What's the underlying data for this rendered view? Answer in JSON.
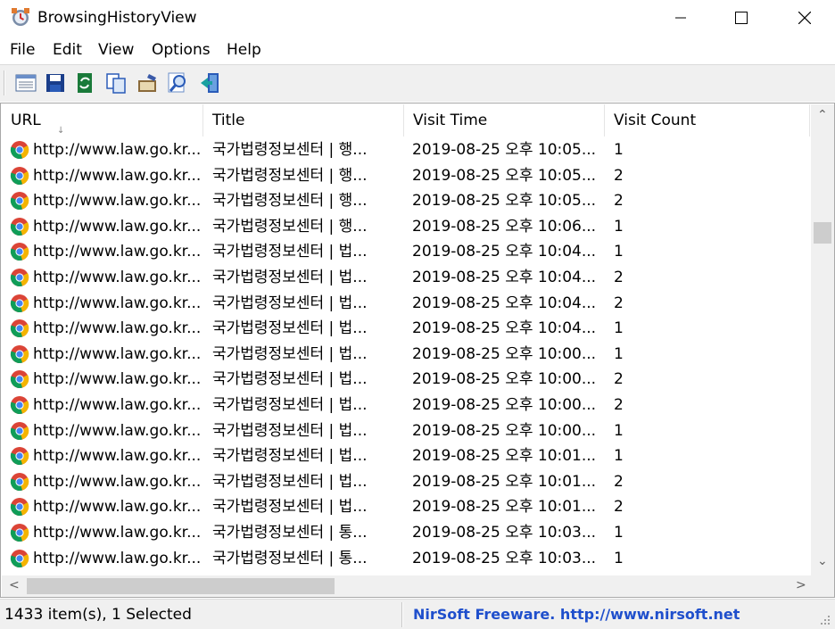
{
  "window": {
    "title": "BrowsingHistoryView",
    "minimize_label": "—",
    "maximize_label": "☐",
    "close_label": "✕"
  },
  "menu": [
    "File",
    "Edit",
    "View",
    "Options",
    "Help"
  ],
  "toolbar": [
    {
      "icon": "properties-icon"
    },
    {
      "icon": "save-icon"
    },
    {
      "icon": "refresh-icon"
    },
    {
      "icon": "copy-icon"
    },
    {
      "icon": "options-icon"
    },
    {
      "icon": "find-icon"
    },
    {
      "icon": "exit-icon"
    }
  ],
  "columns": [
    "URL",
    "Title",
    "Visit Time",
    "Visit Count"
  ],
  "sort_indicator": "↓",
  "rows": [
    {
      "url": "http://www.law.go.kr...",
      "title": "국가법령정보센터 | 행...",
      "time": "2019-08-25 오후 10:05...",
      "count": "1"
    },
    {
      "url": "http://www.law.go.kr...",
      "title": "국가법령정보센터 | 행...",
      "time": "2019-08-25 오후 10:05...",
      "count": "2"
    },
    {
      "url": "http://www.law.go.kr...",
      "title": "국가법령정보센터 | 행...",
      "time": "2019-08-25 오후 10:05...",
      "count": "2"
    },
    {
      "url": "http://www.law.go.kr...",
      "title": "국가법령정보센터 | 행...",
      "time": "2019-08-25 오후 10:06...",
      "count": "1"
    },
    {
      "url": "http://www.law.go.kr...",
      "title": "국가법령정보센터 | 법...",
      "time": "2019-08-25 오후 10:04...",
      "count": "1"
    },
    {
      "url": "http://www.law.go.kr...",
      "title": "국가법령정보센터 | 법...",
      "time": "2019-08-25 오후 10:04...",
      "count": "2"
    },
    {
      "url": "http://www.law.go.kr...",
      "title": "국가법령정보센터 | 법...",
      "time": "2019-08-25 오후 10:04...",
      "count": "2"
    },
    {
      "url": "http://www.law.go.kr...",
      "title": "국가법령정보센터 | 법...",
      "time": "2019-08-25 오후 10:04...",
      "count": "1"
    },
    {
      "url": "http://www.law.go.kr...",
      "title": "국가법령정보센터 | 법...",
      "time": "2019-08-25 오후 10:00...",
      "count": "1"
    },
    {
      "url": "http://www.law.go.kr...",
      "title": "국가법령정보센터 | 법...",
      "time": "2019-08-25 오후 10:00...",
      "count": "2"
    },
    {
      "url": "http://www.law.go.kr...",
      "title": "국가법령정보센터 | 법...",
      "time": "2019-08-25 오후 10:00...",
      "count": "2"
    },
    {
      "url": "http://www.law.go.kr...",
      "title": "국가법령정보센터 | 법...",
      "time": "2019-08-25 오후 10:00...",
      "count": "1"
    },
    {
      "url": "http://www.law.go.kr...",
      "title": "국가법령정보센터 | 법...",
      "time": "2019-08-25 오후 10:01...",
      "count": "1"
    },
    {
      "url": "http://www.law.go.kr...",
      "title": "국가법령정보센터 | 법...",
      "time": "2019-08-25 오후 10:01...",
      "count": "2"
    },
    {
      "url": "http://www.law.go.kr...",
      "title": "국가법령정보센터 | 법...",
      "time": "2019-08-25 오후 10:01...",
      "count": "2"
    },
    {
      "url": "http://www.law.go.kr...",
      "title": "국가법령정보센터 | 통...",
      "time": "2019-08-25 오후 10:03...",
      "count": "1"
    },
    {
      "url": "http://www.law.go.kr...",
      "title": "국가법령정보센터 | 통...",
      "time": "2019-08-25 오후 10:03...",
      "count": "1"
    }
  ],
  "scroll": {
    "up": "⌃",
    "down": "⌄",
    "left": "<",
    "right": ">"
  },
  "status": {
    "items": "1433 item(s), 1 Selected",
    "vendor": "NirSoft Freeware.  http://www.nirsoft.net"
  },
  "colors": {
    "link": "#1f4fcc",
    "chrome_red": "#db4437",
    "chrome_green": "#0f9d58",
    "chrome_yellow": "#f4b400",
    "chrome_blue": "#4285f4"
  }
}
